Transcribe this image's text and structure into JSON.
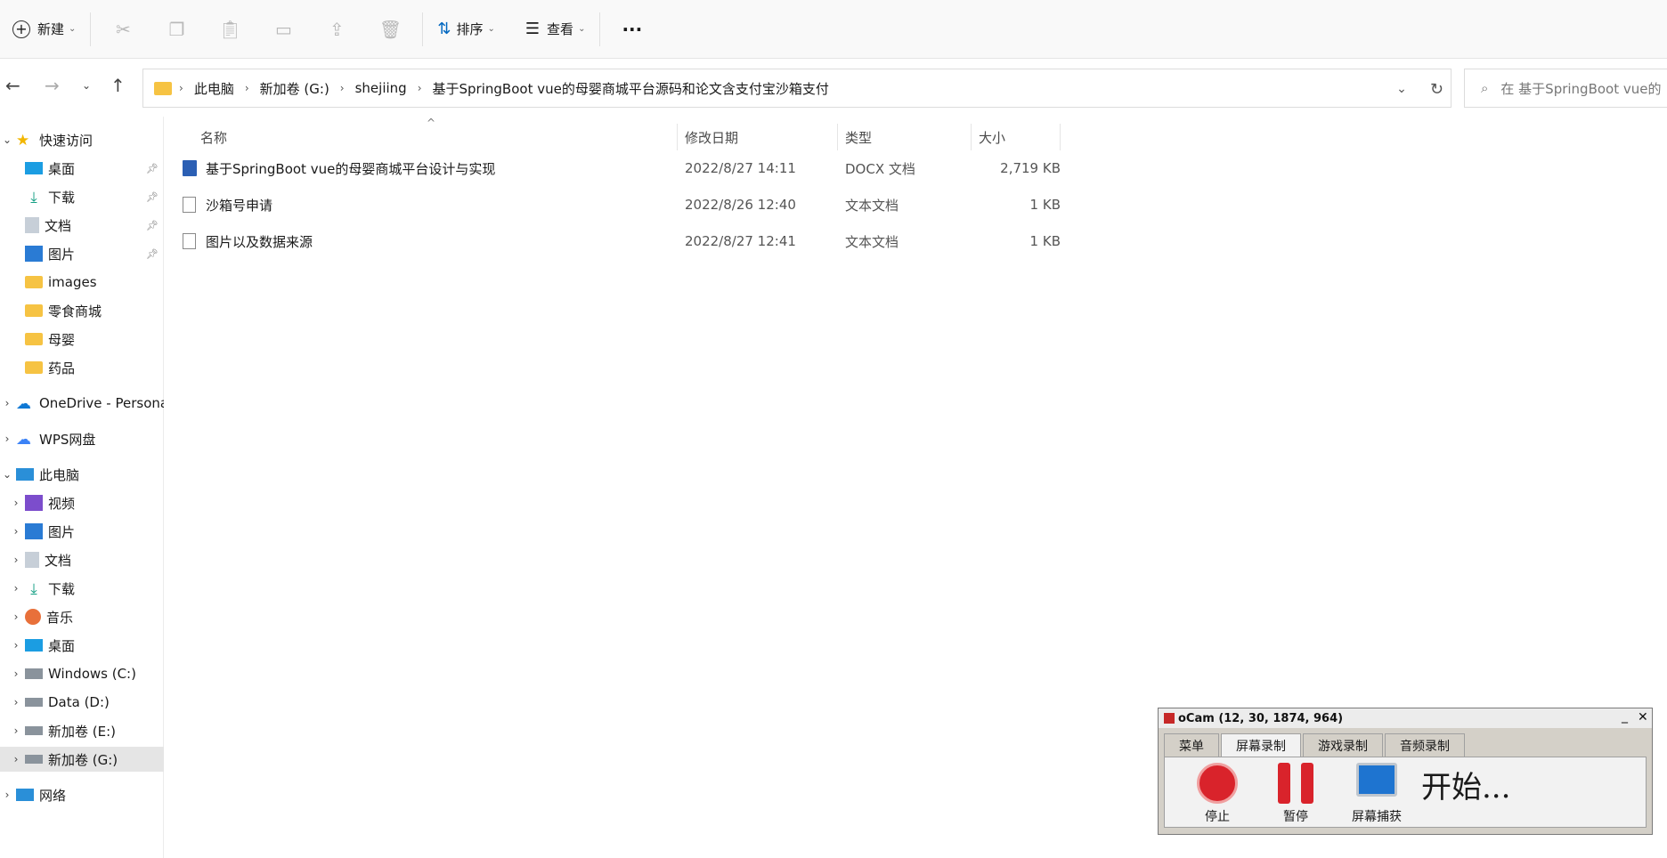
{
  "toolbar": {
    "new_label": "新建",
    "sort_label": "排序",
    "view_label": "查看",
    "more_label": "···"
  },
  "breadcrumbs": [
    "此电脑",
    "新加卷 (G:)",
    "shejiing",
    "基于SpringBoot vue的母婴商城平台源码和论文含支付宝沙箱支付"
  ],
  "search": {
    "placeholder": "在 基于SpringBoot vue的"
  },
  "sidebar": {
    "quick_access": "快速访问",
    "quick_items": [
      "桌面",
      "下载",
      "文档",
      "图片",
      "images",
      "零食商城",
      "母婴",
      "药品"
    ],
    "onedrive": "OneDrive - Persona",
    "wps": "WPS网盘",
    "this_pc": "此电脑",
    "pc_items": [
      "视频",
      "图片",
      "文档",
      "下载",
      "音乐",
      "桌面",
      "Windows (C:)",
      "Data (D:)",
      "新加卷 (E:)",
      "新加卷 (G:)"
    ],
    "network": "网络"
  },
  "columns": {
    "name": "名称",
    "date": "修改日期",
    "type": "类型",
    "size": "大小"
  },
  "files": [
    {
      "name": "基于SpringBoot vue的母婴商城平台设计与实现",
      "date": "2022/8/27 14:11",
      "type": "DOCX 文档",
      "size": "2,719 KB",
      "icon": "docx-icon"
    },
    {
      "name": "沙箱号申请",
      "date": "2022/8/26 12:40",
      "type": "文本文档",
      "size": "1 KB",
      "icon": "text-file-icon"
    },
    {
      "name": "图片以及数据来源",
      "date": "2022/8/27 12:41",
      "type": "文本文档",
      "size": "1 KB",
      "icon": "text-file-icon"
    }
  ],
  "ocam": {
    "title": "oCam (12, 30, 1874, 964)",
    "tabs": [
      "菜单",
      "屏幕录制",
      "游戏录制",
      "音频录制"
    ],
    "stop_label": "停止",
    "pause_label": "暂停",
    "capture_label": "屏幕捕获",
    "status": "开始..."
  },
  "colors": {
    "accent": "#0067c0",
    "folder": "#f6c343",
    "selected": "#e5e5e5",
    "record_red": "#d9232b"
  }
}
